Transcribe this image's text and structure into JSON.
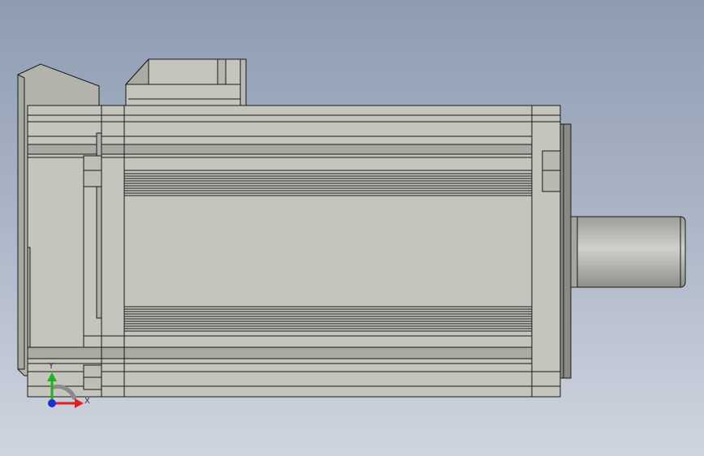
{
  "viewport": {
    "background_top": "#8e9cb2",
    "background_bottom": "#cfd5df",
    "model": {
      "body_color": "#c4c5bd",
      "edge_color": "#1a1a1a",
      "shadow_color": "#9a9b94",
      "part": "servo-motor",
      "view": "side"
    },
    "triad": {
      "x_label": "X",
      "y_label": "Y",
      "x_color": "#e02020",
      "y_color": "#20b020",
      "z_color": "#2030d0"
    }
  }
}
